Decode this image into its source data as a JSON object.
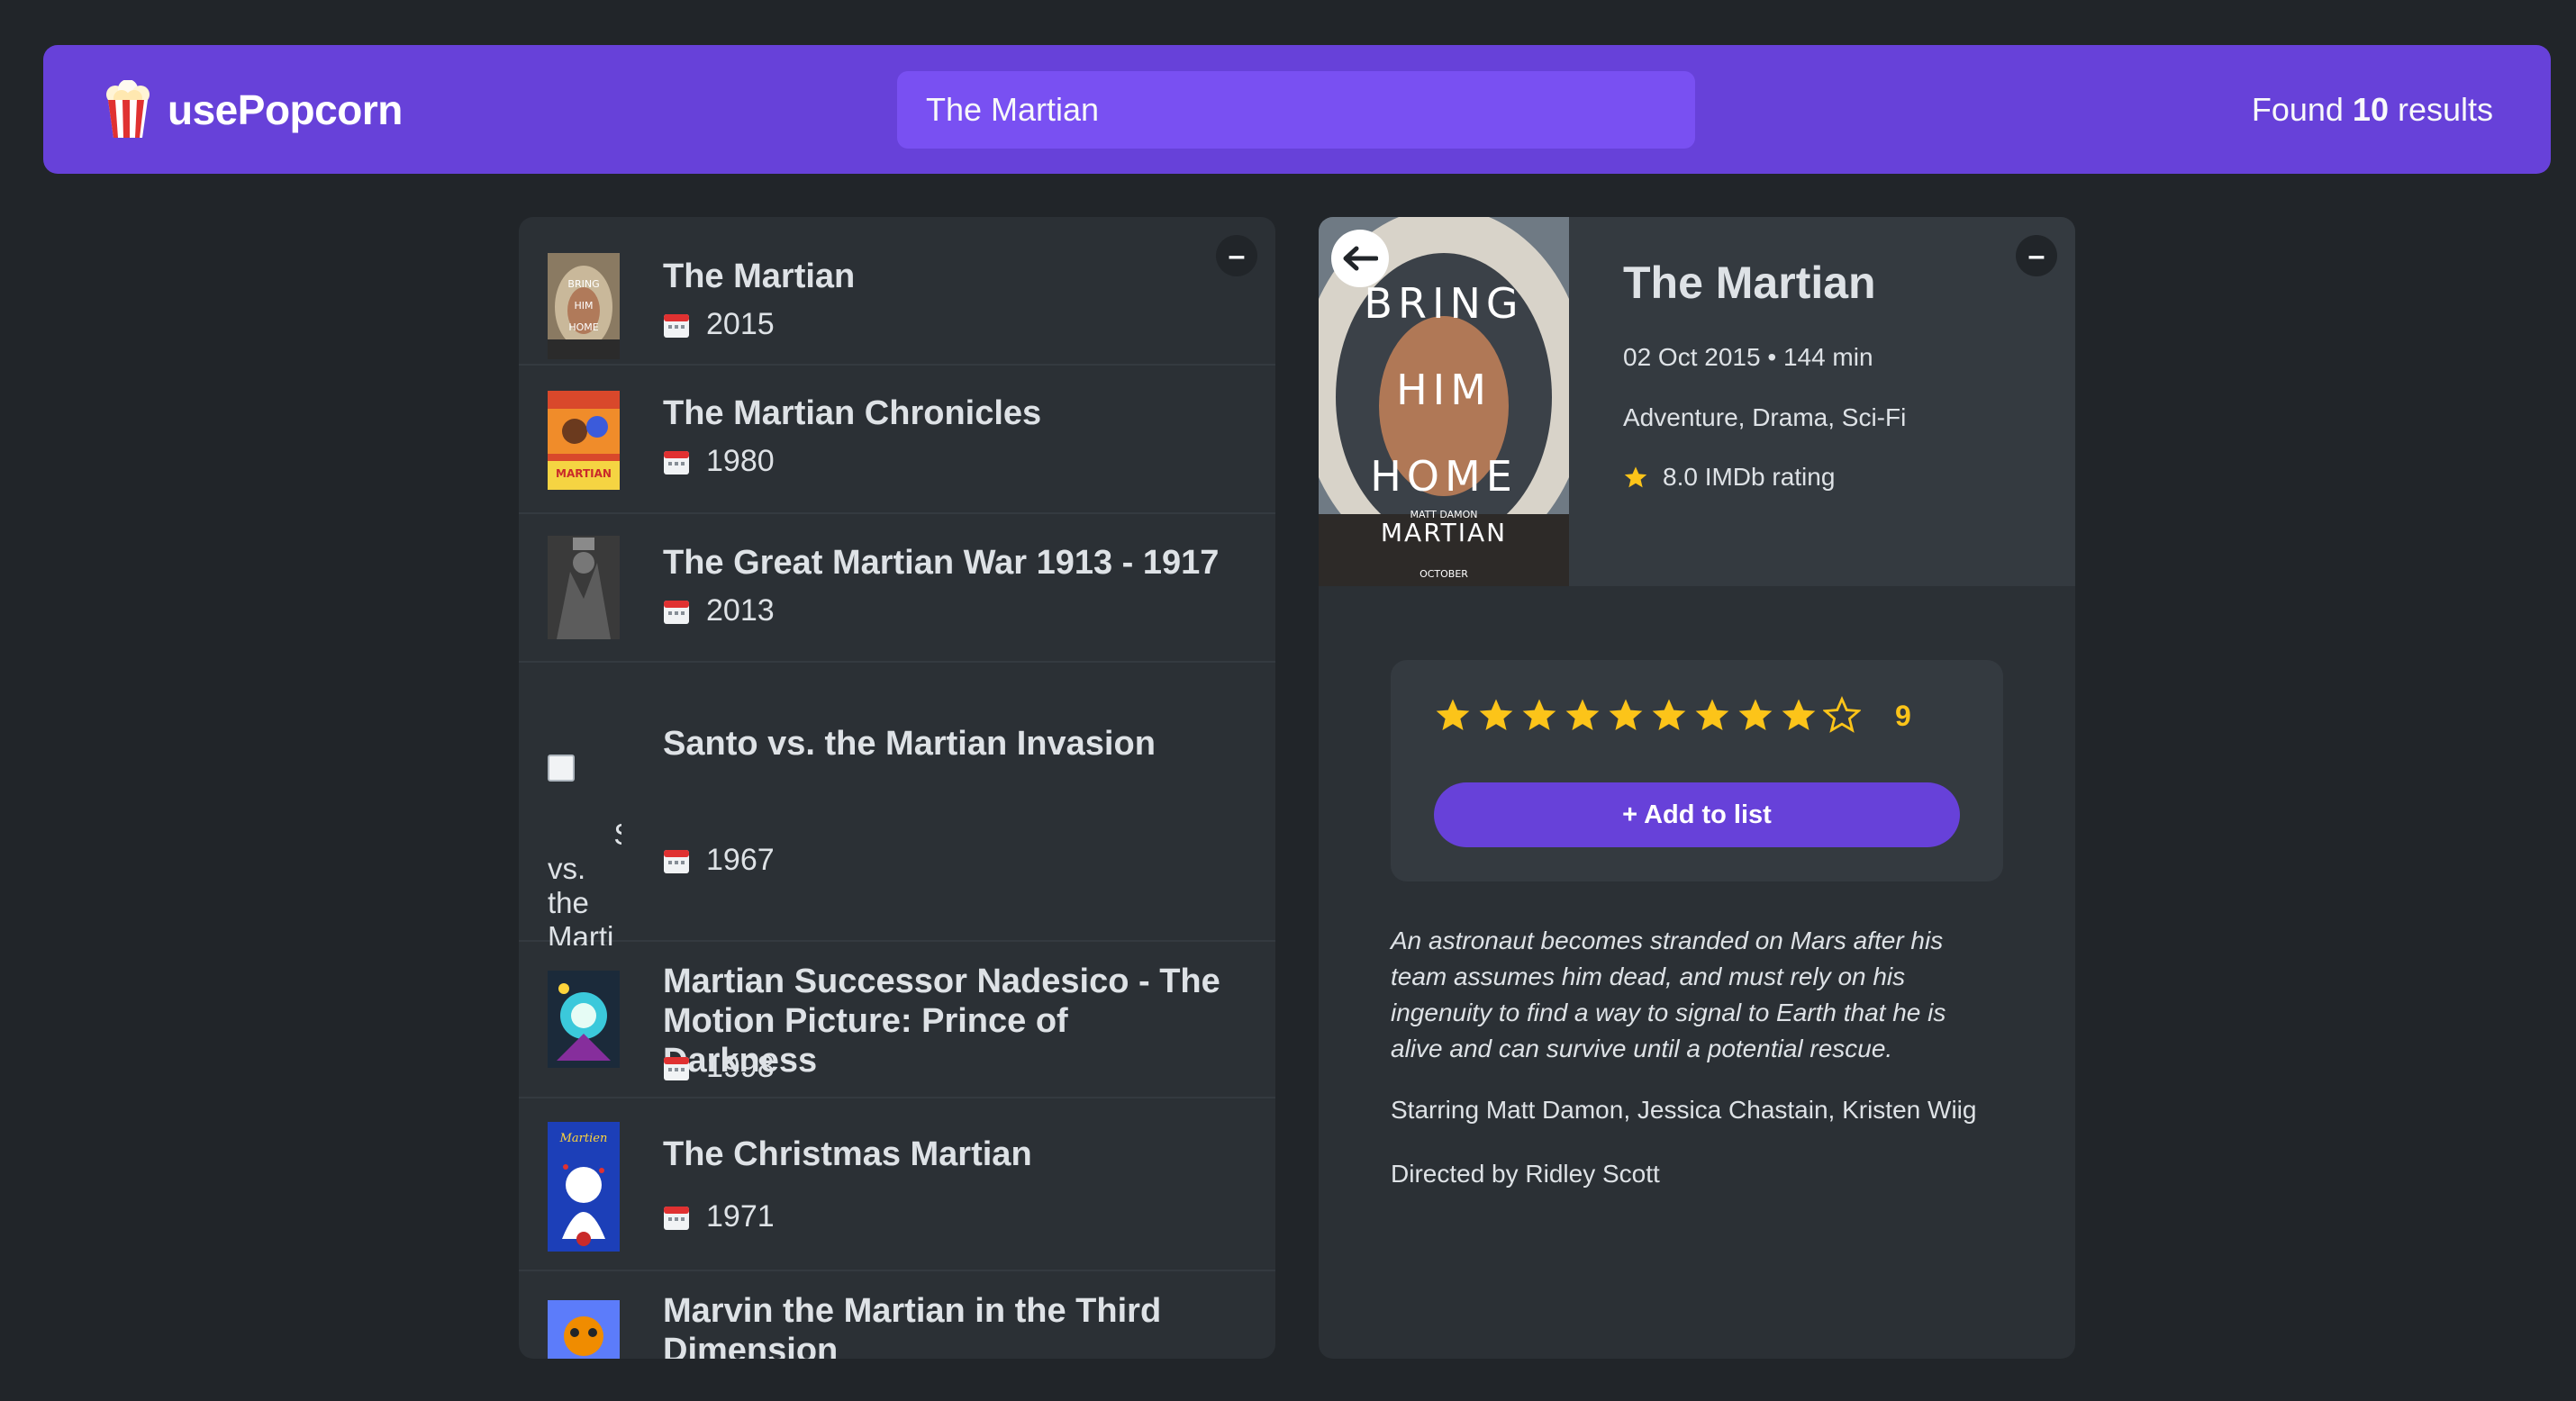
{
  "nav": {
    "logo_text": "usePopcorn",
    "search_value": "The Martian",
    "results_prefix": "Found",
    "results_count": "10",
    "results_suffix": "results"
  },
  "list": {
    "toggle_label": "–",
    "movies": [
      {
        "title": "The Martian",
        "year": "2015"
      },
      {
        "title": "The Martian Chronicles",
        "year": "1980"
      },
      {
        "title": "The Great Martian War 1913 - 1917",
        "year": "2013"
      },
      {
        "title": "Santo vs. the Martian Invasion",
        "year": "1967",
        "poster_alt": "Santo\nvs.\nthe\nMarti\nInvasi\nposte"
      },
      {
        "title": "Martian Successor Nadesico - The Motion Picture: Prince of Darkness",
        "year": "1998"
      },
      {
        "title": "The Christmas Martian",
        "year": "1971"
      },
      {
        "title": "Marvin the Martian in the Third Dimension",
        "year": ""
      }
    ]
  },
  "details": {
    "toggle_label": "–",
    "title": "The Martian",
    "released": "02 Oct 2015",
    "runtime": "144 min",
    "genre": "Adventure, Drama, Sci-Fi",
    "imdb_rating": "8.0 IMDb rating",
    "poster_text": {
      "line1": "BRING",
      "line2": "HIM",
      "line3": "HOME",
      "actor": "MATT DAMON",
      "title": "MARTIAN",
      "date": "OCTOBER"
    },
    "user_rating": "9",
    "user_rating_value": 9,
    "max_rating": 10,
    "add_button": "+ Add to list",
    "plot": "An astronaut becomes stranded on Mars after his team assumes him dead, and must rely on his ingenuity to find a way to signal to Earth that he is alive and can survive until a potential rescue.",
    "starring": "Starring Matt Damon, Jessica Chastain, Kristen Wiig",
    "director": "Directed by Ridley Scott"
  },
  "colors": {
    "background": "#212529",
    "primary": "#6741d9",
    "primary_light": "#7950f2",
    "box": "#2b3035",
    "star": "#fcc419"
  }
}
